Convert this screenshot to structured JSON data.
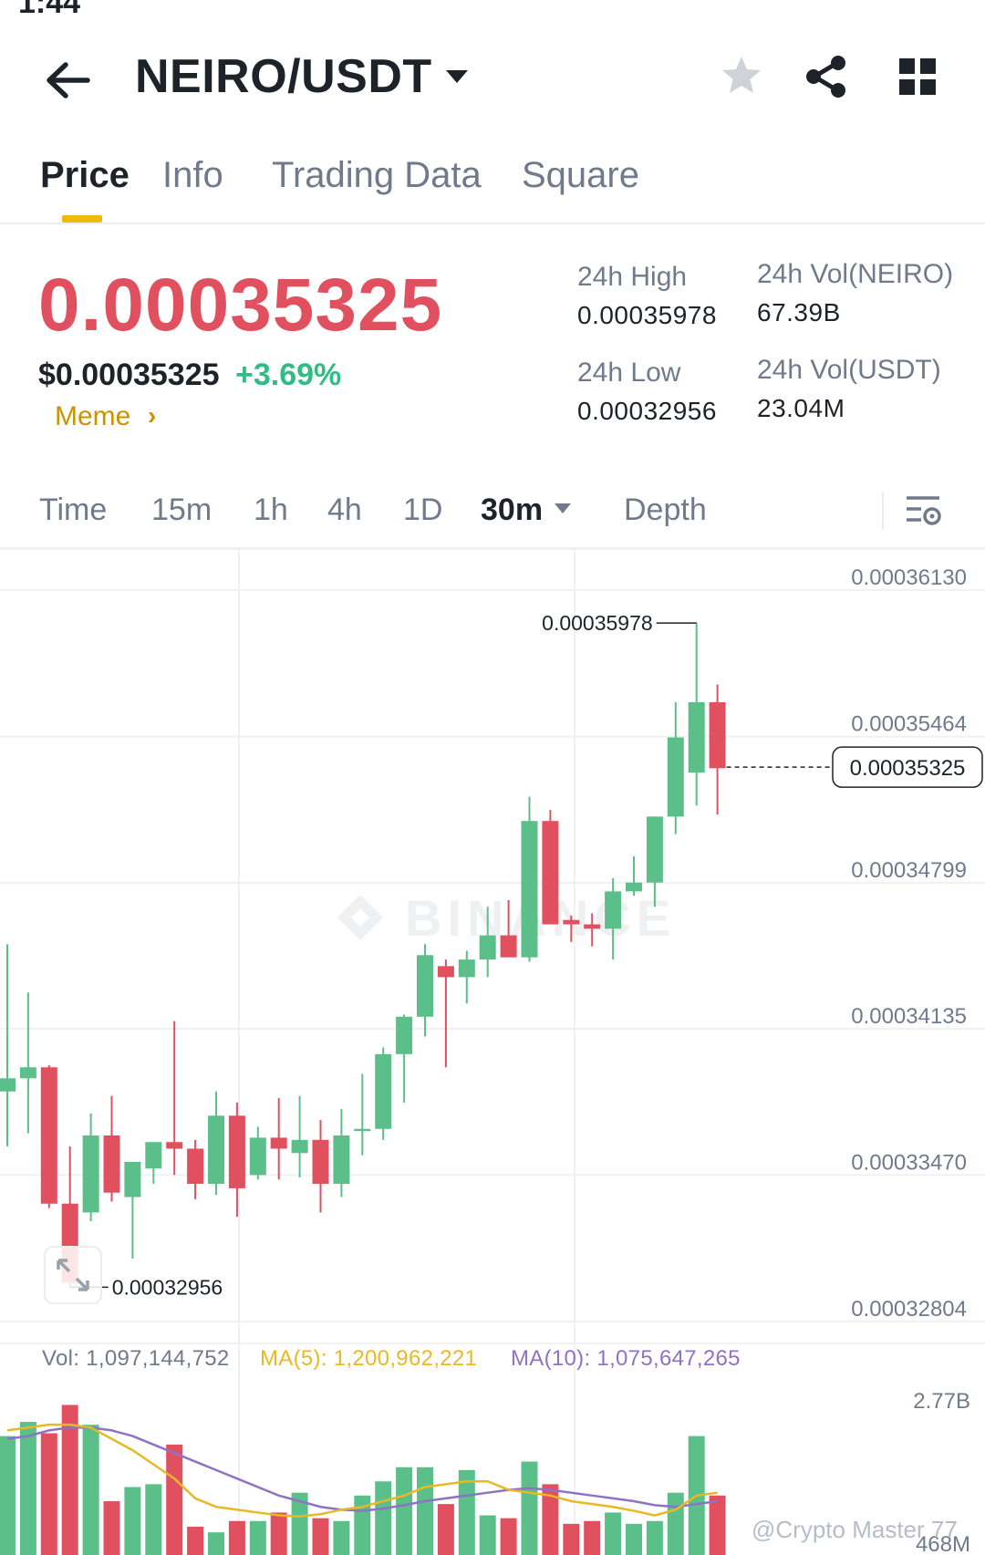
{
  "header": {
    "pair": "NEIRO/USDT",
    "icons": [
      "back-arrow-icon",
      "caret-down-icon",
      "star-icon",
      "share-icon",
      "grid-icon"
    ]
  },
  "tabs": [
    {
      "label": "Price",
      "active": true
    },
    {
      "label": "Info",
      "active": false
    },
    {
      "label": "Trading Data",
      "active": false
    },
    {
      "label": "Square",
      "active": false
    }
  ],
  "ticker": {
    "last_price": "0.00035325",
    "usd_price": "$0.00035325",
    "change": "+3.69%",
    "tag": "Meme",
    "high_label": "24h High",
    "high_value": "0.00035978",
    "low_label": "24h Low",
    "low_value": "0.00032956",
    "vol_base_label": "24h Vol(NEIRO)",
    "vol_base_value": "67.39B",
    "vol_quote_label": "24h Vol(USDT)",
    "vol_quote_value": "23.04M"
  },
  "timeframes": {
    "items": [
      "Time",
      "15m",
      "1h",
      "4h",
      "1D"
    ],
    "selected": "30m",
    "depth": "Depth"
  },
  "colors": {
    "up": "#5bbf8a",
    "down": "#e0505f",
    "ma5": "#e8b923",
    "ma10": "#8e72c4",
    "price_red": "#e0505f",
    "accent": "#f0b90b"
  },
  "chart_data": {
    "type": "candlestick",
    "price_axis_labels": [
      "0.00036130",
      "0.00035464",
      "0.00034799",
      "0.00034135",
      "0.00033470",
      "0.00032804"
    ],
    "price_axis_values": [
      0.0003613,
      0.00035464,
      0.00034799,
      0.00034135,
      0.0003347,
      0.00032804
    ],
    "last_price_label": "0.00035325",
    "last_price": 0.00035325,
    "high_label": "0.00035978",
    "low_label": "0.00032956",
    "watermark": "BINANCE",
    "candles": [
      {
        "o": 0.0003385,
        "h": 0.0003452,
        "l": 0.000336,
        "c": 0.0003391
      },
      {
        "o": 0.0003391,
        "h": 0.000343,
        "l": 0.0003366,
        "c": 0.0003396
      },
      {
        "o": 0.0003396,
        "h": 0.0003397,
        "l": 0.0003332,
        "c": 0.0003334
      },
      {
        "o": 0.0003334,
        "h": 0.000336,
        "l": 0.0003296,
        "c": 0.0003298
      },
      {
        "o": 0.000333,
        "h": 0.0003375,
        "l": 0.0003326,
        "c": 0.0003365
      },
      {
        "o": 0.0003365,
        "h": 0.0003383,
        "l": 0.0003335,
        "c": 0.0003339
      },
      {
        "o": 0.0003337,
        "h": 0.0003352,
        "l": 0.0003309,
        "c": 0.0003353
      },
      {
        "o": 0.000335,
        "h": 0.0003362,
        "l": 0.0003343,
        "c": 0.0003362
      },
      {
        "o": 0.0003362,
        "h": 0.0003417,
        "l": 0.0003347,
        "c": 0.0003359
      },
      {
        "o": 0.0003359,
        "h": 0.0003363,
        "l": 0.0003336,
        "c": 0.0003343
      },
      {
        "o": 0.0003343,
        "h": 0.0003385,
        "l": 0.0003338,
        "c": 0.0003374
      },
      {
        "o": 0.0003374,
        "h": 0.000338,
        "l": 0.0003328,
        "c": 0.0003341
      },
      {
        "o": 0.0003347,
        "h": 0.0003369,
        "l": 0.0003345,
        "c": 0.0003364
      },
      {
        "o": 0.0003364,
        "h": 0.0003382,
        "l": 0.0003345,
        "c": 0.0003359
      },
      {
        "o": 0.0003357,
        "h": 0.0003383,
        "l": 0.0003346,
        "c": 0.0003363
      },
      {
        "o": 0.0003363,
        "h": 0.0003372,
        "l": 0.000333,
        "c": 0.0003343
      },
      {
        "o": 0.0003343,
        "h": 0.0003377,
        "l": 0.0003337,
        "c": 0.0003365
      },
      {
        "o": 0.0003367,
        "h": 0.0003393,
        "l": 0.0003356,
        "c": 0.0003368
      },
      {
        "o": 0.0003368,
        "h": 0.0003405,
        "l": 0.0003363,
        "c": 0.0003402
      },
      {
        "o": 0.0003402,
        "h": 0.000342,
        "l": 0.000338,
        "c": 0.0003419
      },
      {
        "o": 0.0003419,
        "h": 0.0003452,
        "l": 0.000341,
        "c": 0.0003447
      },
      {
        "o": 0.0003442,
        "h": 0.0003445,
        "l": 0.0003396,
        "c": 0.0003437
      },
      {
        "o": 0.0003437,
        "h": 0.0003449,
        "l": 0.0003425,
        "c": 0.0003445
      },
      {
        "o": 0.0003445,
        "h": 0.0003469,
        "l": 0.0003437,
        "c": 0.0003456
      },
      {
        "o": 0.0003456,
        "h": 0.0003472,
        "l": 0.0003452,
        "c": 0.0003446
      },
      {
        "o": 0.0003446,
        "h": 0.0003519,
        "l": 0.0003444,
        "c": 0.0003508
      },
      {
        "o": 0.0003508,
        "h": 0.0003513,
        "l": 0.0003462,
        "c": 0.0003461
      },
      {
        "o": 0.0003463,
        "h": 0.0003465,
        "l": 0.0003453,
        "c": 0.0003461
      },
      {
        "o": 0.0003461,
        "h": 0.0003466,
        "l": 0.0003451,
        "c": 0.0003459
      },
      {
        "o": 0.0003459,
        "h": 0.0003482,
        "l": 0.0003445,
        "c": 0.0003476
      },
      {
        "o": 0.0003476,
        "h": 0.0003492,
        "l": 0.0003474,
        "c": 0.000348
      },
      {
        "o": 0.000348,
        "h": 0.000351,
        "l": 0.0003469,
        "c": 0.000351
      },
      {
        "o": 0.000351,
        "h": 0.0003562,
        "l": 0.0003502,
        "c": 0.0003546
      },
      {
        "o": 0.000353,
        "h": 0.0003598,
        "l": 0.0003515,
        "c": 0.0003562
      },
      {
        "o": 0.0003562,
        "h": 0.000357,
        "l": 0.0003511,
        "c": 0.0003532
      }
    ],
    "volume": {
      "legend_vol": "Vol: 1,097,144,752",
      "legend_ma5": "MA(5): 1,200,962,221",
      "legend_ma10": "MA(10): 1,075,647,265",
      "axis_top_label": "2.77B",
      "axis_top_value": 2770000000,
      "axis_bottom_label": "468M",
      "bars": [
        2.1,
        2.35,
        2.15,
        2.65,
        2.3,
        0.95,
        1.2,
        1.25,
        1.95,
        0.5,
        0.4,
        0.6,
        0.6,
        0.75,
        1.1,
        0.65,
        0.6,
        1.05,
        1.3,
        1.55,
        1.55,
        0.9,
        1.5,
        0.7,
        0.65,
        1.65,
        1.25,
        0.55,
        0.6,
        0.75,
        0.55,
        0.6,
        1.1,
        2.1,
        1.05
      ],
      "ma5": [
        2.2,
        2.25,
        2.3,
        2.3,
        2.25,
        2.05,
        1.85,
        1.6,
        1.35,
        1.0,
        0.85,
        0.8,
        0.75,
        0.7,
        0.68,
        0.72,
        0.8,
        0.85,
        0.95,
        1.05,
        1.2,
        1.25,
        1.3,
        1.3,
        1.15,
        1.1,
        1.05,
        0.95,
        0.9,
        0.85,
        0.78,
        0.7,
        0.8,
        1.05,
        1.1
      ],
      "ma10": [
        2.05,
        2.1,
        2.2,
        2.25,
        2.25,
        2.2,
        2.1,
        1.95,
        1.8,
        1.65,
        1.5,
        1.35,
        1.2,
        1.05,
        0.95,
        0.85,
        0.8,
        0.78,
        0.82,
        0.88,
        0.95,
        1.0,
        1.05,
        1.1,
        1.15,
        1.18,
        1.15,
        1.1,
        1.05,
        1.0,
        0.95,
        0.88,
        0.85,
        0.9,
        0.95
      ]
    }
  },
  "watermark_text": "@Crypto Master 77"
}
